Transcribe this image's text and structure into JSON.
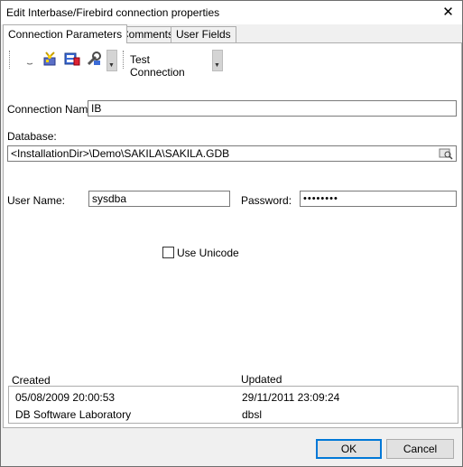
{
  "window": {
    "title": "Edit Interbase/Firebird connection properties",
    "close_glyph": "✕"
  },
  "tabs": [
    {
      "label": "Connection Parameters"
    },
    {
      "label": "Comments"
    },
    {
      "label": "User Fields"
    }
  ],
  "toolbar": {
    "test_connection_label": "Test Connection",
    "dropdown_glyph": "▼"
  },
  "form": {
    "connection_name_label": "Connection Name:",
    "connection_name_value": "IB",
    "database_label": "Database:",
    "database_value": "<InstallationDir>\\Demo\\SAKILA\\SAKILA.GDB",
    "username_label": "User Name:",
    "username_value": "sysdba",
    "password_label": "Password:",
    "password_value": "••••••••",
    "unicode_label": "Use Unicode"
  },
  "info": {
    "created_label": "Created",
    "updated_label": "Updated",
    "created_date": "05/08/2009 20:00:53",
    "updated_date": "29/11/2011 23:09:24",
    "created_by": "DB Software Laboratory",
    "updated_by": "dbsl"
  },
  "buttons": {
    "ok": "OK",
    "cancel": "Cancel"
  },
  "colors": {
    "accent": "#0078d7"
  }
}
